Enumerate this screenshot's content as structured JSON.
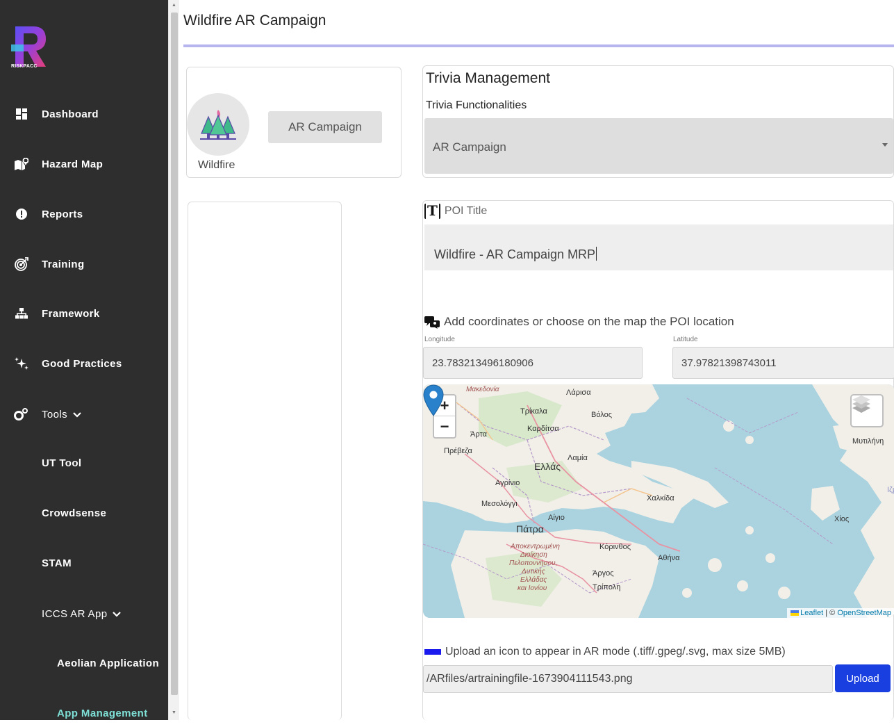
{
  "sidebar": {
    "logo_text": "RISKPACC",
    "items": [
      {
        "label": "Dashboard",
        "icon": "dashboard-icon"
      },
      {
        "label": "Hazard Map",
        "icon": "map-icon"
      },
      {
        "label": "Reports",
        "icon": "alert-icon"
      },
      {
        "label": "Training",
        "icon": "target-icon"
      },
      {
        "label": "Framework",
        "icon": "sitemap-icon"
      },
      {
        "label": "Good Practices",
        "icon": "sparkles-icon"
      },
      {
        "label": "Tools",
        "icon": "gears-icon"
      }
    ],
    "tools_sub": [
      "UT Tool",
      "Crowdsense",
      "STAM"
    ],
    "iccs_label": "ICCS AR App",
    "iccs_sub": [
      "Aeolian Application",
      "App Management"
    ]
  },
  "header": {
    "title": "Wildfire AR Campaign"
  },
  "campaign_card": {
    "hazard_label": "Wildfire",
    "button_label": "AR Campaign"
  },
  "trivia": {
    "title": "Trivia Management",
    "subtitle": "Trivia Functionalities",
    "selected": "AR Campaign"
  },
  "poi": {
    "title_label": "POI Title",
    "title_value": "Wildfire - AR Campaign MRP",
    "coords_label": "Add coordinates or choose on the map the POI location",
    "longitude_label": "Longitude",
    "latitude_label": "Latitude",
    "longitude_value": "23.783213496180906",
    "latitude_value": "37.97821398743011"
  },
  "map": {
    "zoom_in": "+",
    "zoom_out": "−",
    "attribution_leaflet": "Leaflet",
    "attribution_sep": " | © ",
    "attribution_osm": "OpenStreetMap",
    "place_labels": [
      "Μακεδονία",
      "Λάρισα",
      "Τρίκαλα",
      "Βόλος",
      "Καρδίτσα",
      "Άρτα",
      "Πρέβεζα",
      "Ελλάς",
      "Λαμία",
      "Αγρίνιο",
      "Μεσολόγγι",
      "Χαλκίδα",
      "Αίγιο",
      "Πάτρα",
      "Κόρινθος",
      "Αθήνα",
      "Άργος",
      "Τρίπολη",
      "Μυτιλήνη",
      "Χίος",
      "Ιζμ"
    ],
    "region_label": [
      "Αποκεντρωμένη",
      "Διοίκηση",
      "Πελοποννήσου,",
      "Δυτικής",
      "Ελλάδας",
      "και Ιονίου"
    ]
  },
  "upload": {
    "label": "Upload an icon to appear in AR mode (.tiff/.gpeg/.svg, max size 5MB)",
    "path": "/ARfiles/artrainingfile-1673904111543.png",
    "button_label": "Upload"
  },
  "colors": {
    "sidebar_bg": "#2e2e2e",
    "accent_underline": "#b7b5ee",
    "upload_button": "#1a3fe0",
    "active_nav": "#7ee0d6"
  }
}
